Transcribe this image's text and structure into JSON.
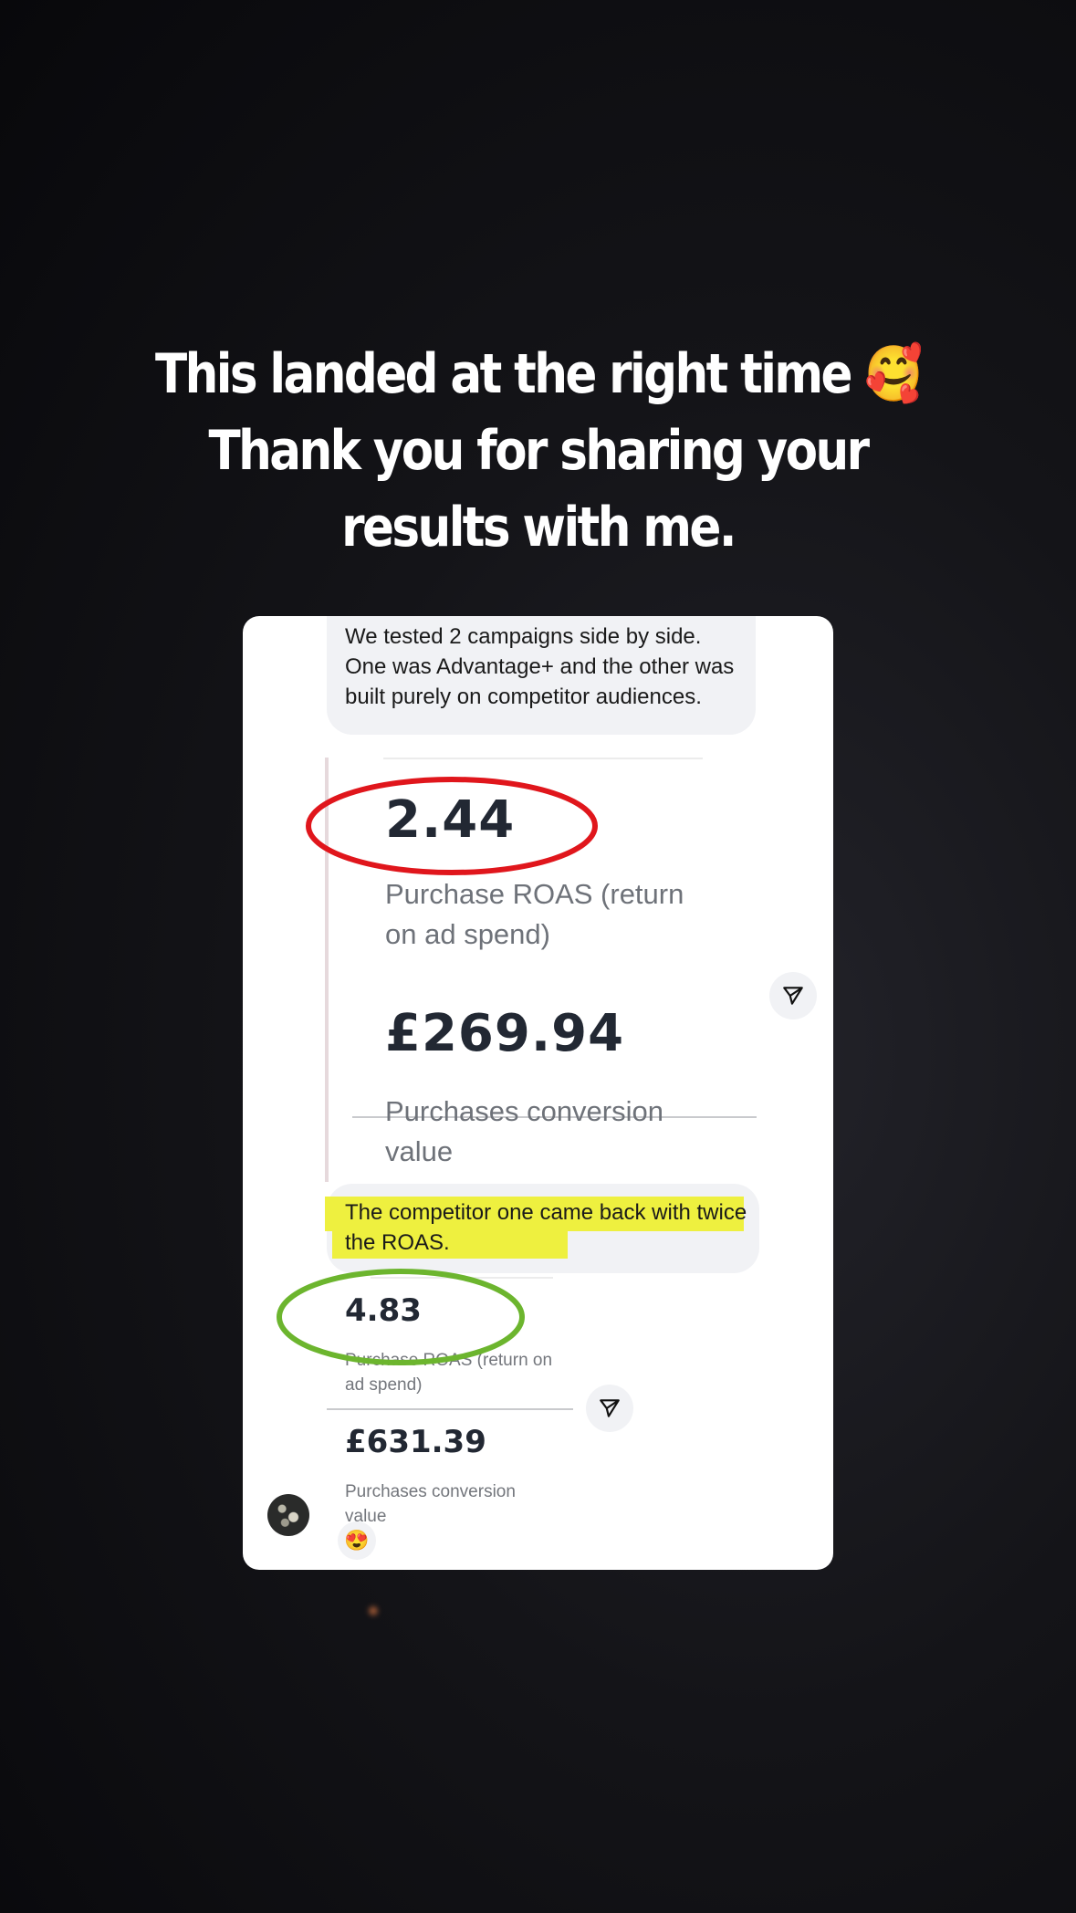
{
  "story": {
    "caption": [
      "This landed at the right time 🥰",
      "Thank you for sharing your",
      "results with me."
    ]
  },
  "dm_screenshot": {
    "message_1": "We tested 2 campaigns side by side. One was Advantage+ and the other was built purely on competitor audiences.",
    "campaign_a": {
      "roas_value": "2.44",
      "roas_label": "Purchase ROAS (return on ad spend)",
      "conversion_value": "£269.94",
      "conversion_label": "Purchases conversion value"
    },
    "message_2": "The competitor one came back with twice the ROAS.",
    "campaign_b": {
      "roas_value": "4.83",
      "roas_label": "Purchase ROAS (return on ad spend)",
      "conversion_value": "£631.39",
      "conversion_label": "Purchases conversion value"
    },
    "reaction_emoji": "😍"
  },
  "annotations": {
    "red_circle_color": "#e0161c",
    "green_circle_color": "#6cb52e",
    "highlight_color": "#eef03f"
  },
  "icons": {
    "share": "send-icon",
    "avatar": "avatar"
  }
}
